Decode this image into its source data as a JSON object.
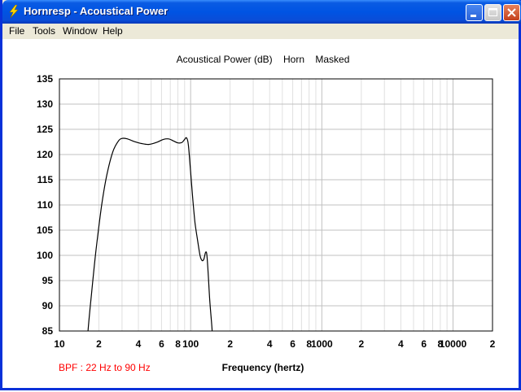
{
  "window": {
    "title": "Hornresp - Acoustical Power"
  },
  "menu": {
    "items": [
      "File",
      "Tools",
      "Window",
      "Help"
    ]
  },
  "colors": {
    "titlebar": "#0054e3",
    "bpf_text": "#ff0000",
    "curve": "#000000",
    "grid_major": "#c0c0c0",
    "grid_minor": "#e0e0e0"
  },
  "icons": {
    "app": "lightning-icon",
    "minimize": "minimize-icon",
    "maximize": "maximize-icon",
    "close": "close-icon"
  },
  "status": {
    "bpf": "BPF : 22 Hz to 90 Hz"
  },
  "chart_data": {
    "type": "line",
    "title": "Acoustical Power (dB)    Horn    Masked",
    "xlabel": "Frequency (hertz)",
    "ylabel": "",
    "xscale": "log",
    "xlim": [
      10,
      20000
    ],
    "ylim": [
      85,
      135
    ],
    "x_tick_labels": [
      {
        "value": 10,
        "label": "10"
      },
      {
        "value": 20,
        "label": "2"
      },
      {
        "value": 40,
        "label": "4"
      },
      {
        "value": 60,
        "label": "6"
      },
      {
        "value": 80,
        "label": "8"
      },
      {
        "value": 100,
        "label": "100"
      },
      {
        "value": 200,
        "label": "2"
      },
      {
        "value": 400,
        "label": "4"
      },
      {
        "value": 600,
        "label": "6"
      },
      {
        "value": 800,
        "label": "8"
      },
      {
        "value": 1000,
        "label": "1000"
      },
      {
        "value": 2000,
        "label": "2"
      },
      {
        "value": 4000,
        "label": "4"
      },
      {
        "value": 6000,
        "label": "6"
      },
      {
        "value": 8000,
        "label": "8"
      },
      {
        "value": 10000,
        "label": "10000"
      },
      {
        "value": 20000,
        "label": "2"
      }
    ],
    "y_ticks": [
      85,
      90,
      95,
      100,
      105,
      110,
      115,
      120,
      125,
      130,
      135
    ],
    "grid": true,
    "series": [
      {
        "points": [
          [
            16.5,
            85
          ],
          [
            17.5,
            92
          ],
          [
            19,
            101
          ],
          [
            21,
            110
          ],
          [
            23,
            116
          ],
          [
            25.5,
            120.5
          ],
          [
            28,
            122.6
          ],
          [
            30,
            123.2
          ],
          [
            33,
            123.1
          ],
          [
            37,
            122.6
          ],
          [
            42,
            122.2
          ],
          [
            48,
            122.0
          ],
          [
            55,
            122.4
          ],
          [
            62,
            123.0
          ],
          [
            68,
            123.1
          ],
          [
            74,
            122.7
          ],
          [
            80,
            122.3
          ],
          [
            86,
            122.4
          ],
          [
            90,
            123.0
          ],
          [
            93,
            123.3
          ],
          [
            96,
            122.0
          ],
          [
            100,
            116.5
          ],
          [
            104,
            111.0
          ],
          [
            108,
            106.5
          ],
          [
            113,
            103.0
          ],
          [
            118,
            100.0
          ],
          [
            122,
            99.0
          ],
          [
            126,
            99.2
          ],
          [
            130,
            100.6
          ],
          [
            133,
            100.1
          ],
          [
            136,
            96.5
          ],
          [
            140,
            91.0
          ],
          [
            144,
            87.0
          ],
          [
            146,
            85.0
          ]
        ]
      }
    ]
  }
}
